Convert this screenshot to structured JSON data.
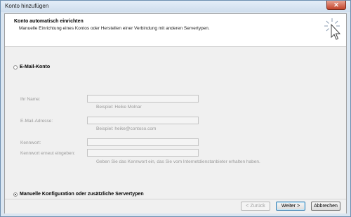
{
  "window": {
    "title": "Konto hinzufügen",
    "close_glyph": "✕"
  },
  "header": {
    "title": "Konto automatisch einrichten",
    "subtitle": "Manuelle Einrichtung eines Kontos oder Herstellen einer Verbindung mit anderen Servertypen.",
    "icon": "cursor-click-icon"
  },
  "email_option": {
    "label": "E-Mail-Konto",
    "selected": false
  },
  "form": {
    "name_label": "Ihr Name:",
    "name_value": "",
    "name_hint": "Beispiel: Heike Molnar",
    "email_label": "E-Mail-Adresse:",
    "email_value": "",
    "email_hint": "Beispiel: heike@contoso.com",
    "password_label": "Kennwort:",
    "password_value": "",
    "password_repeat_label": "Kennwort erneut eingeben:",
    "password_repeat_value": "",
    "password_hint": "Geben Sie das Kennwort ein, das Sie vom Internetdienstanbieter erhalten haben."
  },
  "manual_option": {
    "label": "Manuelle Konfiguration oder zusätzliche Servertypen",
    "selected": true
  },
  "buttons": {
    "back": "< Zurück",
    "next": "Weiter >",
    "cancel": "Abbrechen"
  }
}
